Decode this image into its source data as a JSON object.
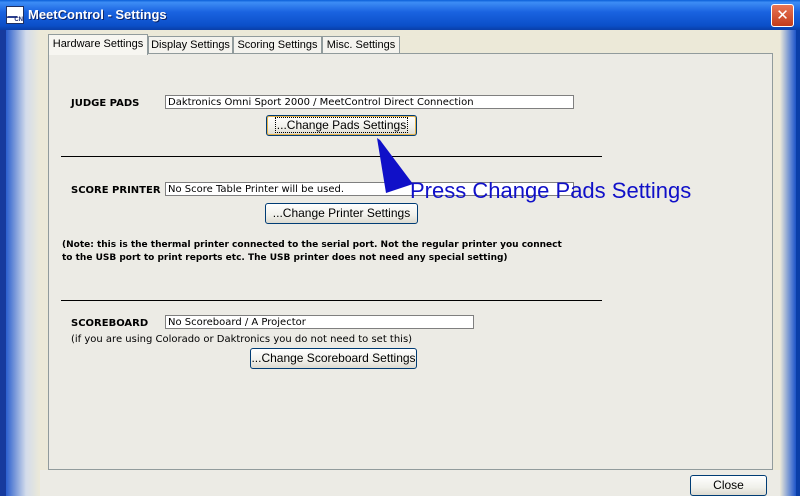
{
  "window": {
    "title": "MeetControl - Settings",
    "icon": "app-icon",
    "icon_text": "CN"
  },
  "tabs": [
    {
      "label": "Hardware Settings",
      "active": true
    },
    {
      "label": "Display Settings",
      "active": false
    },
    {
      "label": "Scoring Settings",
      "active": false
    },
    {
      "label": "Misc. Settings",
      "active": false
    }
  ],
  "judge_pads": {
    "label": "JUDGE PADS",
    "value": "Daktronics Omni Sport 2000 / MeetControl Direct Connection",
    "button": "...Change Pads Settings"
  },
  "score_printer": {
    "label": "SCORE PRINTER",
    "value": "No Score Table Printer will be used.",
    "button": "...Change Printer Settings"
  },
  "note": {
    "line1": "(Note:  this is the thermal printer connected to the serial port. Not the regular printer you connect",
    "line2": "to the USB port to print reports etc. The USB printer does not need any special setting)"
  },
  "scoreboard": {
    "label": "SCOREBOARD",
    "value": "No Scoreboard / A Projector",
    "hint": "(if you are using Colorado or Daktronics you do not need to set this)",
    "button": "...Change Scoreboard Settings"
  },
  "annotation": {
    "text": "Press Change Pads Settings",
    "color": "#1010c8"
  },
  "footer": {
    "close_button": "Close"
  },
  "colors": {
    "titlebar": "#0b4fc9",
    "panel": "#ecebe5",
    "close_x": "#c23b1a"
  }
}
